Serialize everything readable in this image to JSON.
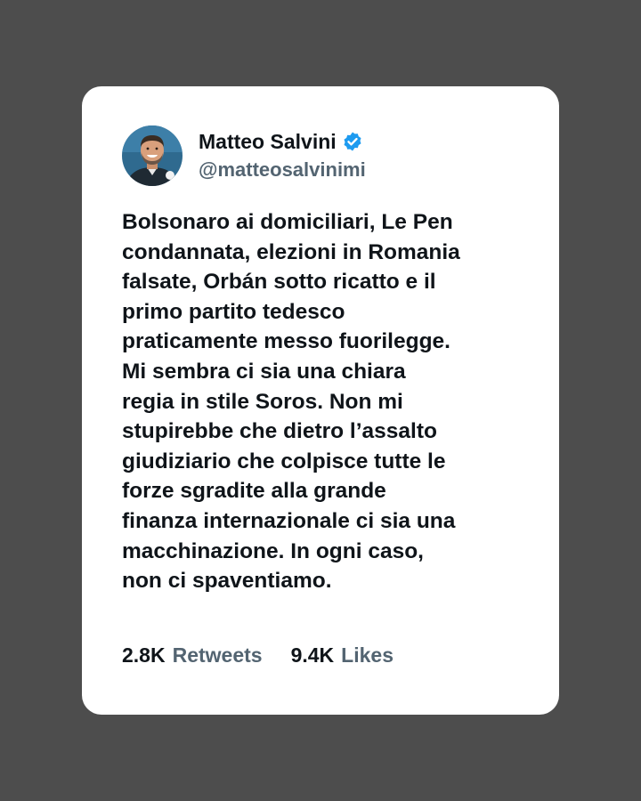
{
  "tweet": {
    "author": {
      "name": "Matteo Salvini",
      "handle": "@matteosalvinimi",
      "verified": true,
      "avatar_icon": "profile-photo"
    },
    "text": "Bolsonaro ai domiciliari, Le Pen\ncondannata, elezioni in Romania\nfalsate, Orbán sotto ricatto e il\nprimo partito tedesco\npraticamente messo fuorilegge.\nMi sembra ci sia una chiara\nregia in stile Soros. Non mi\nstupirebbe che dietro l’assalto\ngiudiziario che colpisce tutte le\nforze sgradite alla grande\nfinanza internazionale ci sia una\nmacchinazione. In ogni caso,\nnon ci spaventiamo.",
    "stats": {
      "retweets_count": "2.8K",
      "retweets_label": "Retweets",
      "likes_count": "9.4K",
      "likes_label": "Likes"
    }
  },
  "colors": {
    "background": "#4d4d4d",
    "card": "#ffffff",
    "text_primary": "#0f1419",
    "text_secondary": "#536471",
    "verified_badge": "#1d9bf0"
  }
}
